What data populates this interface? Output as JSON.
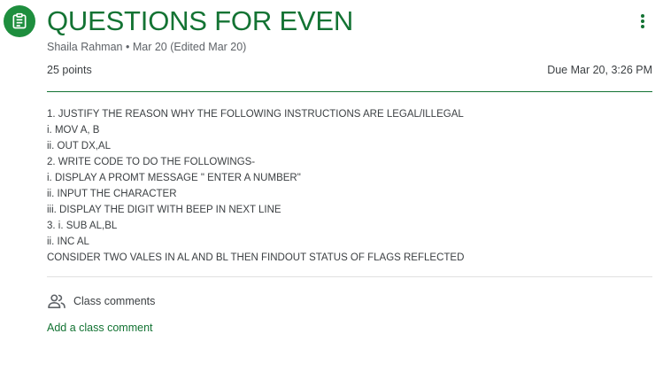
{
  "assignment": {
    "icon": "assignment-icon",
    "title": "QUESTIONS FOR EVEN",
    "author": "Shaila Rahman",
    "separator": "•",
    "date": "Mar 20 (Edited Mar 20)",
    "points": "25 points",
    "due": "Due Mar 20, 3:26 PM"
  },
  "instructions": [
    "1. JUSTIFY THE REASON WHY THE FOLLOWING INSTRUCTIONS ARE LEGAL/ILLEGAL",
    "i. MOV A, B",
    "ii. OUT DX,AL",
    "2. WRITE CODE TO DO THE FOLLOWINGS-",
    "i. DISPLAY A PROMT MESSAGE \" ENTER A NUMBER\"",
    "ii. INPUT THE CHARACTER",
    "iii. DISPLAY THE DIGIT WITH BEEP IN NEXT LINE",
    "3. i. SUB AL,BL",
    "ii. INC AL",
    "CONSIDER TWO VALES IN AL AND BL THEN FINDOUT STATUS OF FLAGS REFLECTED"
  ],
  "comments": {
    "icon": "people-icon",
    "label": "Class comments",
    "add_label": "Add a class comment"
  },
  "colors": {
    "accent": "#137333",
    "icon_bg": "#1e8e3e",
    "text": "#3c4043",
    "muted": "#5f6368",
    "divider": "#e0e0e0"
  },
  "more_icon": "more-vert-icon"
}
